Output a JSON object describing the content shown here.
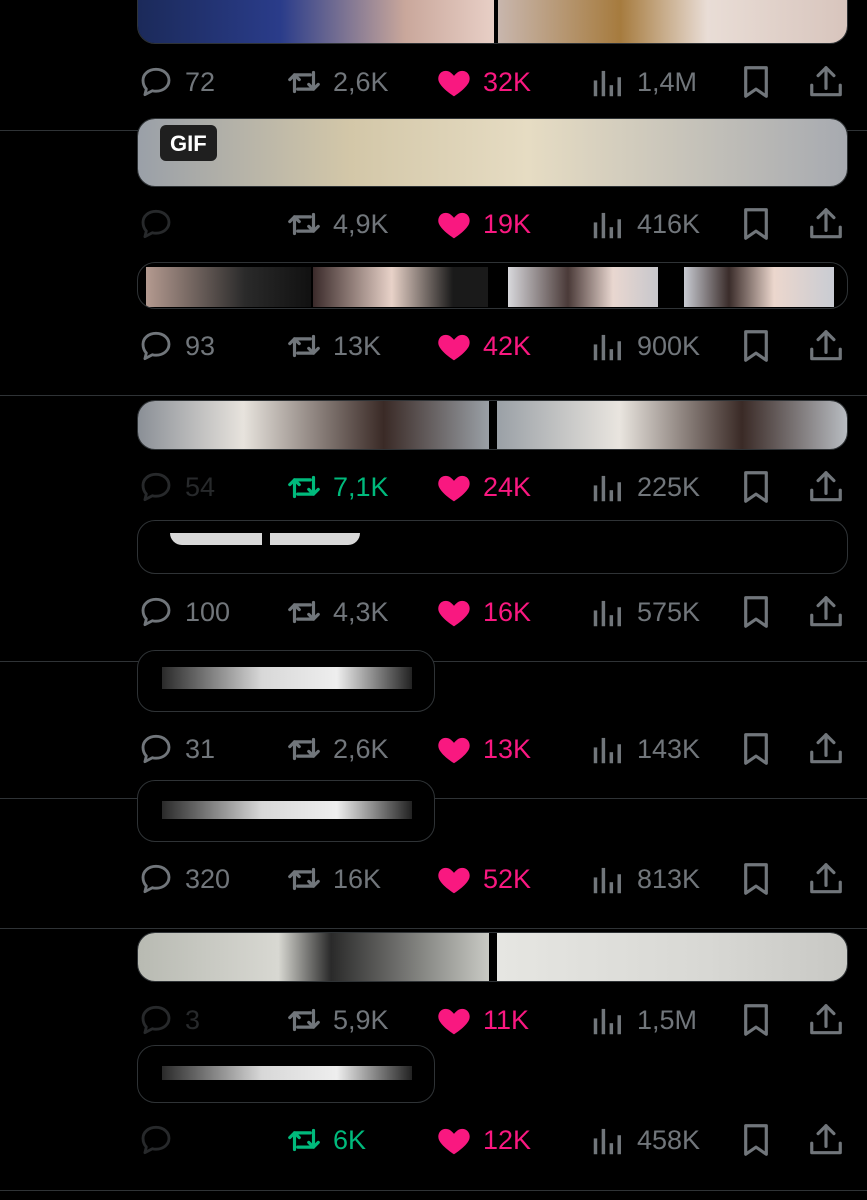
{
  "theme": {
    "background": "#000000",
    "muted": "#71767b",
    "like_color": "#f91880",
    "retweet_color": "#00ba7c",
    "divider": "#2f3336"
  },
  "icons": {
    "reply": "speech-bubble",
    "retweet": "retweet-arrows",
    "like": "heart",
    "views": "bar-chart",
    "bookmark": "bookmark",
    "share": "share-upload"
  },
  "tweets": [
    {
      "media_badge": "",
      "replies": "72",
      "retweets": "2,6K",
      "likes": "32K",
      "views": "1,4M"
    },
    {
      "media_badge": "GIF",
      "replies": "",
      "retweets": "4,9K",
      "likes": "19K",
      "views": "416K"
    },
    {
      "media_badge": "",
      "replies": "93",
      "retweets": "13K",
      "likes": "42K",
      "views": "900K"
    },
    {
      "media_badge": "",
      "replies": "54",
      "retweets": "7,1K",
      "likes": "24K",
      "views": "225K"
    },
    {
      "media_badge": "",
      "replies": "100",
      "retweets": "4,3K",
      "likes": "16K",
      "views": "575K"
    },
    {
      "media_badge": "",
      "replies": "31",
      "retweets": "2,6K",
      "likes": "13K",
      "views": "143K"
    },
    {
      "media_badge": "",
      "replies": "320",
      "retweets": "16K",
      "likes": "52K",
      "views": "813K"
    },
    {
      "media_badge": "",
      "replies": "3",
      "retweets": "5,9K",
      "likes": "11K",
      "views": "1,5M"
    },
    {
      "media_badge": "",
      "replies": "",
      "retweets": "6K",
      "likes": "12K",
      "views": "458K"
    }
  ]
}
